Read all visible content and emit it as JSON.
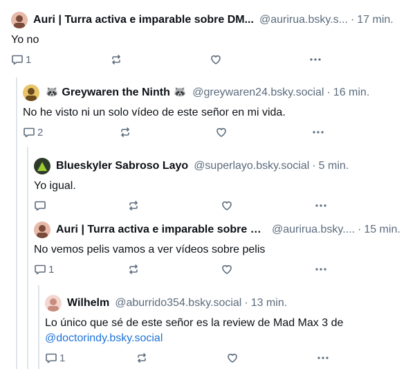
{
  "posts": [
    {
      "name": "Auri | Turra activa e imparable sobre DM...",
      "handle": "@aurirua.bsky.s...",
      "time": "17 min.",
      "text": "Yo no",
      "reply_count": "1",
      "colors": {
        "avatar_bg": "#e7b9a8",
        "avatar_fg": "#7a4a3a"
      }
    },
    {
      "name": "🦝 Greywaren the Ninth 🦝",
      "handle": "@greywaren24.bsky.social",
      "time": "16 min.",
      "text": "No he visto ni un solo vídeo de este señor en mi vida.",
      "reply_count": "2",
      "colors": {
        "avatar_bg": "#e9c46a",
        "avatar_fg": "#6b4a1e"
      }
    },
    {
      "name": "Blueskyler Sabroso Layo",
      "handle": "@superlayo.bsky.social",
      "time": "5 min.",
      "text": "Yo igual.",
      "reply_count": "",
      "colors": {
        "avatar_bg": "#2f3b2a",
        "avatar_fg": "#9acd32"
      }
    },
    {
      "name": "Auri | Turra activa e imparable sobre D...",
      "handle": "@aurirua.bsky....",
      "time": "15 min.",
      "text": "No vemos pelis vamos a ver vídeos sobre pelis",
      "reply_count": "1",
      "colors": {
        "avatar_bg": "#e7b9a8",
        "avatar_fg": "#7a4a3a"
      }
    },
    {
      "name": "Wilhelm",
      "handle": "@aburrido354.bsky.social",
      "time": "13 min.",
      "text": "Lo único que sé de este señor es la review de Mad Max 3 de",
      "mention": "@doctorindy.bsky.social",
      "reply_count": "1",
      "colors": {
        "avatar_bg": "#f3d6cf",
        "avatar_fg": "#c98d7e"
      }
    }
  ],
  "time_separator": "·",
  "colors": {
    "thread_line": "#dfe4ea",
    "muted": "#5b6b7c",
    "link": "#1e73d8"
  }
}
